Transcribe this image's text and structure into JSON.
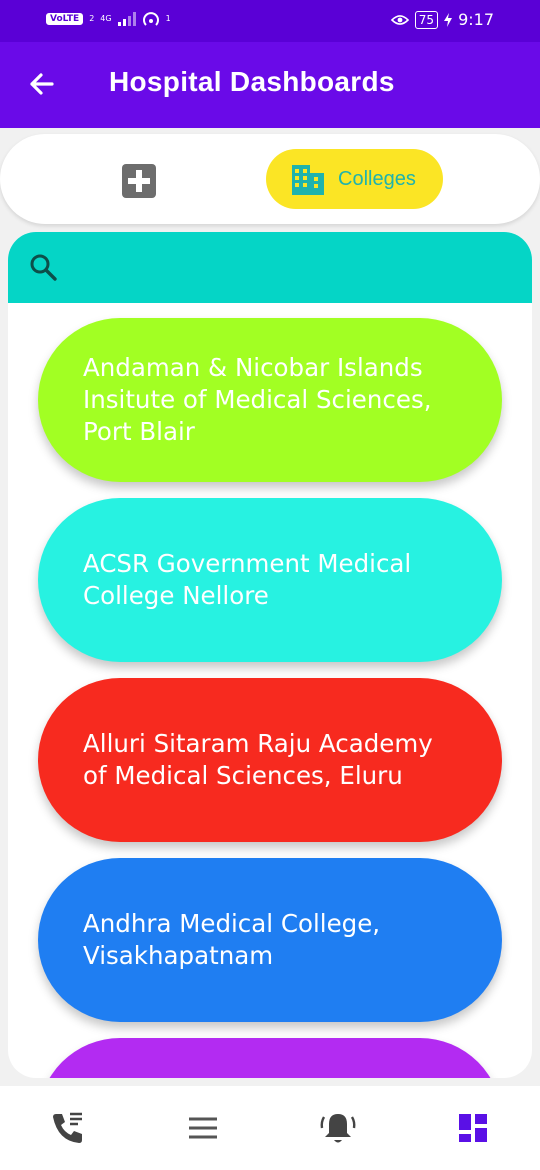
{
  "status_bar": {
    "volte": "VoLTE",
    "sim": "2",
    "network": "4G",
    "hotspot_count": "1",
    "battery": "75",
    "time": "9:17"
  },
  "app_bar": {
    "title": "Hospital Dashboards"
  },
  "tabs": {
    "colleges_label": "Colleges"
  },
  "search": {
    "placeholder": ""
  },
  "colleges": [
    {
      "name": "Andaman & Nicobar Islands Insitute of Medical Sciences, Port Blair",
      "color": "#a2ff23"
    },
    {
      "name": "ACSR Government Medical College Nellore",
      "color": "#27f2e1"
    },
    {
      "name": "Alluri Sitaram Raju Academy of Medical Sciences, Eluru",
      "color": "#f72a1f"
    },
    {
      "name": "Andhra Medical College, Visakhapatnam",
      "color": "#1f7ef2"
    },
    {
      "name": "",
      "color": "#b32bf2"
    }
  ],
  "colors": {
    "primary": "#6a0ae8",
    "accent_teal": "#05d5c6",
    "tab_yellow": "#fbe525",
    "nav_active": "#5a10e6"
  }
}
